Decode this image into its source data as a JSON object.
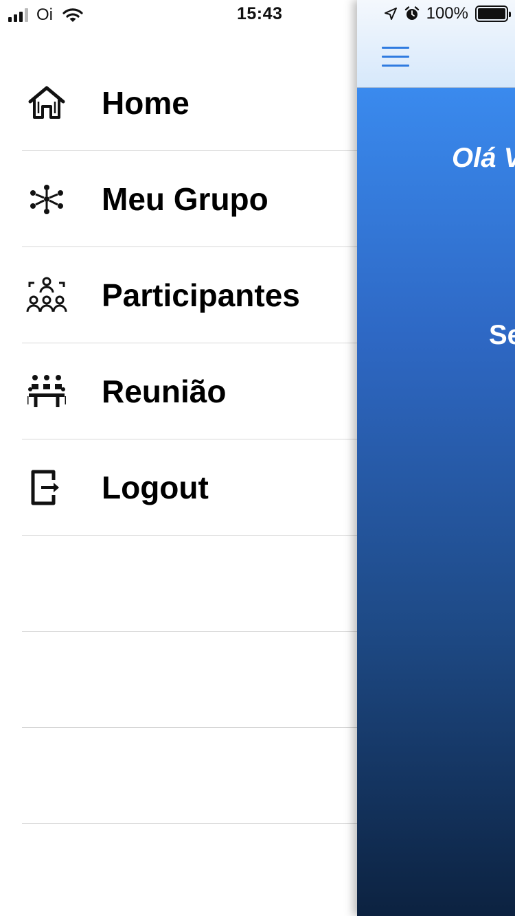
{
  "status_bar": {
    "carrier": "Oi",
    "time": "15:43",
    "battery_percent": "100%",
    "signal_bars_active": 3,
    "signal_bars_total": 4,
    "battery_level": 1.0
  },
  "drawer": {
    "items": [
      {
        "label": "Home",
        "icon": "home-icon"
      },
      {
        "label": "Meu Grupo",
        "icon": "group-network-icon"
      },
      {
        "label": "Participantes",
        "icon": "participants-icon"
      },
      {
        "label": "Reunião",
        "icon": "meeting-icon"
      },
      {
        "label": "Logout",
        "icon": "logout-icon"
      }
    ]
  },
  "main": {
    "greeting": "Olá V",
    "subtext": "Se",
    "colors": {
      "navbar_accent": "#2f7be0",
      "gradient_top": "#3a8aee",
      "gradient_bottom": "#0c2240"
    }
  }
}
